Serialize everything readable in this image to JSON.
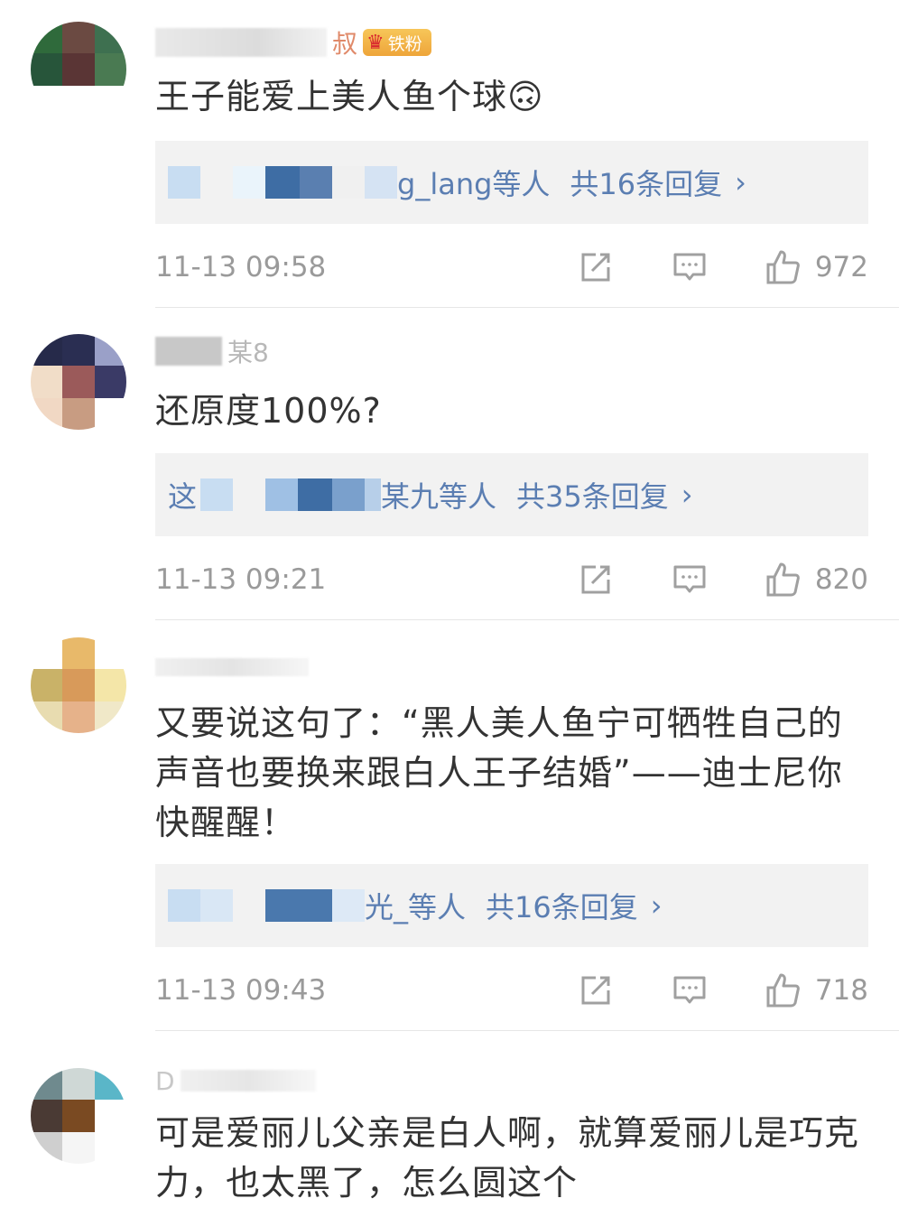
{
  "comments": [
    {
      "username": "叔",
      "badge": "铁粉",
      "text": "王子能爱上美人鱼个球🙃",
      "reply_names": "g_lang等人",
      "reply_count": "共16条回复",
      "chevron": "›",
      "time": "11-13 09:58",
      "likes": "972",
      "avatar_colors": [
        "#2f6a3b",
        "#6b4a42",
        "#3e7050",
        "#27553a",
        "#5a3535",
        "#4a7a52",
        "#ffffff",
        "#ffffff",
        "#ffffff"
      ]
    },
    {
      "username": "某8",
      "text": "还原度100%?",
      "reply_names": "某九等人",
      "reply_count": "共35条回复",
      "chevron": "›",
      "time": "11-13 09:21",
      "likes": "820",
      "avatar_colors": [
        "#262a4a",
        "#2a2e52",
        "#9aa0c8",
        "#f1ddc8",
        "#9b5a5a",
        "#3a3a66",
        "#f1d8c4",
        "#c89c82",
        "#ffffff"
      ]
    },
    {
      "username": "",
      "text": "又要说这句了：“黑人美人鱼宁可牺牲自己的声音也要换来跟白人王子结婚”——迪士尼你快醒醒！",
      "reply_names": "光_等人",
      "reply_count": "共16条回复",
      "chevron": "›",
      "time": "11-13 09:43",
      "likes": "718",
      "avatar_colors": [
        "#ffffff",
        "#e8b96a",
        "#ffffff",
        "#c9b268",
        "#d89a5a",
        "#f4e6a8",
        "#e8dcb0",
        "#e6b28a",
        "#f0e8c8"
      ]
    },
    {
      "username": "D",
      "text": "可是爱丽儿父亲是白人啊，就算爱丽儿是巧克力，也太黑了，怎么圆这个",
      "avatar_colors": [
        "#6f8a8e",
        "#cfd8d6",
        "#5ab6c8",
        "#4a3a34",
        "#7a4a22",
        "#ffffff",
        "#cfcfcf",
        "#f5f5f5",
        "#ffffff"
      ]
    }
  ],
  "icons": {
    "share": "share-icon",
    "comment": "comment-icon",
    "like": "thumbs-up-icon"
  }
}
